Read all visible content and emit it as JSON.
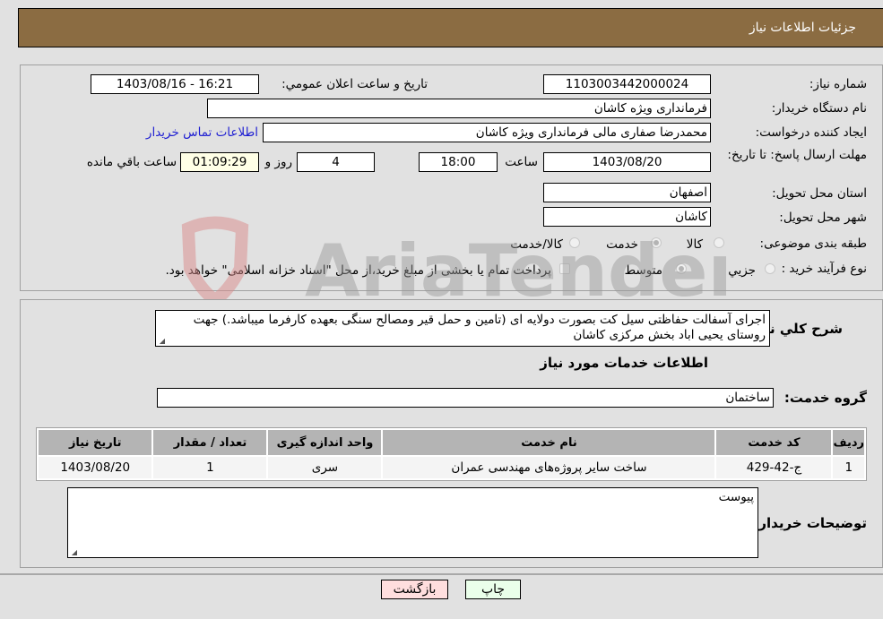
{
  "header": {
    "title": "جزئیات اطلاعات نیاز"
  },
  "fields": {
    "need_number_label": "شماره نیاز:",
    "need_number": "1103003442000024",
    "announce_label": "تاریخ و ساعت اعلان عمومي:",
    "announce_value": "1403/08/16 - 16:21",
    "buyer_org_label": "نام دستگاه خریدار:",
    "buyer_org": "فرمانداری ویژه کاشان",
    "creator_label": "ایجاد کننده درخواست:",
    "creator": "محمدرضا صفاری مالی فرمانداری ویژه کاشان",
    "contact_link": "اطلاعات تماس خریدار",
    "deadline_label": "مهلت ارسال پاسخ: تا تاریخ:",
    "deadline_date": "1403/08/20",
    "time_label": "ساعت",
    "deadline_time": "18:00",
    "days": "4",
    "days_label": "روز و",
    "remaining": "01:09:29",
    "remaining_label": "ساعت باقي مانده",
    "province_label": "استان محل تحویل:",
    "province": "اصفهان",
    "city_label": "شهر محل تحویل:",
    "city": "کاشان",
    "category_label": "طبقه بندی موضوعی:",
    "category_options": [
      "کالا",
      "خدمت",
      "کالا/خدمت"
    ],
    "category_selected": "خدمت",
    "process_label": "نوع فرآیند خرید :",
    "process_options": [
      "جزيي",
      "متوسط"
    ],
    "process_selected": "متوسط",
    "payment_note": "پرداخت تمام یا بخشی از مبلغ خرید،از محل \"اسناد خزانه اسلامی\" خواهد بود."
  },
  "description": {
    "label": "شرح کلي نياز:",
    "text": "اجرای آسفالت حفاظتی سیل کت بصورت دولایه ای (تامین و حمل قیر ومصالح سنگی بعهده کارفرما میباشد.) جهت روستای یحیی اباد بخش مرکزی کاشان"
  },
  "services": {
    "section_title": "اطلاعات خدمات مورد نیاز",
    "group_label": "گروه خدمت:",
    "group_value": "ساختمان",
    "columns": [
      "ردیف",
      "کد خدمت",
      "نام خدمت",
      "واحد اندازه گیری",
      "تعداد / مقدار",
      "تاریخ نیاز"
    ],
    "rows": [
      [
        "1",
        "ج-42-429",
        "ساخت سایر پروژه‌های مهندسی عمران",
        "سری",
        "1",
        "1403/08/20"
      ]
    ]
  },
  "buyer_notes": {
    "label": "توضیحات خریدار:",
    "text": "پیوست"
  },
  "buttons": {
    "print": "چاپ",
    "back": "بازگشت"
  },
  "watermark": {
    "text": "AriaTender.neT"
  }
}
